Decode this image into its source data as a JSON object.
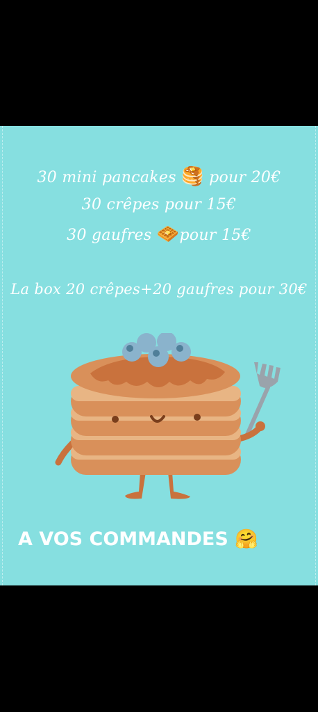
{
  "offers": [
    {
      "text_before": "30 mini pancakes ",
      "emoji": "🥞",
      "text_after": " pour 20€"
    },
    {
      "text_before": "30 crêpes  pour 15€",
      "emoji": "",
      "text_after": ""
    },
    {
      "text_before": "30 gaufres ",
      "emoji": "🧇",
      "text_after": "pour 15€"
    }
  ],
  "box_offer": "La box 20 crêpes+20 gaufres pour 30€",
  "cta": {
    "text": "A VOS COMMANDES ",
    "emoji": "🤗"
  },
  "colors": {
    "background": "#86dfe0",
    "text": "#ffffff",
    "pancake": "#d9905a",
    "syrup": "#c9723d",
    "blueberry": "#8ab3cc"
  },
  "illustration": {
    "icon": "pancake-mascot-icon"
  }
}
